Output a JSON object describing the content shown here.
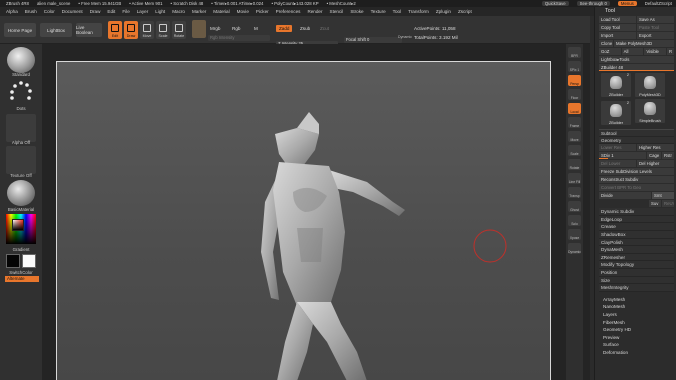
{
  "titlebar": {
    "app": "ZBrush 4R8",
    "file": "alien male_scene",
    "free_mem": "• Free Mem 15.941GB",
    "active_mem": "• Active Mem 901",
    "scratch": "• Scratch Disk 48",
    "timer": "• Timer▸0.001 ATime▸0.024",
    "polycount": "• PolyCount▸143.028 KP",
    "meshcount": "• MeshCount▸2",
    "quicksave": "QuickSave",
    "see_through": "See-through 0",
    "menus": "Menus",
    "default_script": "DefaultZScript"
  },
  "menubar": [
    "Alpha",
    "Brush",
    "Color",
    "Document",
    "Draw",
    "Edit",
    "File",
    "Layer",
    "Light",
    "Macro",
    "Marker",
    "Material",
    "Movie",
    "Picker",
    "Preferences",
    "Render",
    "Stencil",
    "Stroke",
    "Texture",
    "Tool",
    "Transform",
    "Zplugin",
    "Zscript"
  ],
  "shelf": {
    "home_page": "Home Page",
    "lightbox": "LightBox",
    "live_boolean": "Live Boolean",
    "tools": [
      {
        "label": "Edit",
        "icon": "edit-icon",
        "active": true
      },
      {
        "label": "Draw",
        "icon": "draw-icon",
        "active": true
      },
      {
        "label": "Move",
        "icon": "move-icon",
        "active": false
      },
      {
        "label": "Scale",
        "icon": "scale-icon",
        "active": false
      },
      {
        "label": "Rotate",
        "icon": "rotate-icon",
        "active": false
      }
    ],
    "mrgb": "Mrgb",
    "rgb": "Rgb",
    "m": "M",
    "zadd": "Zadd",
    "zsub": "Zsub",
    "zcut": "Zcut",
    "rgb_intensity": "Rgb Intensity",
    "z_intensity": "Z Intensity 25",
    "z_intensity_value": 25,
    "focal_shift": "Focal Shift 0",
    "draw_size": "Draw Size 64",
    "draw_size_value": 64,
    "dynamic": "Dynamic",
    "active_points": "ActivePoints: 11,058",
    "total_points": "TotalPoints: 3.192 Mil"
  },
  "leftpanel": {
    "brush": "Standard",
    "stroke": "Dots",
    "alpha": "Alpha Off",
    "texture": "Texture Off",
    "material": "BasicMaterial",
    "gradient": "Gradient",
    "switch_color": "SwitchColor",
    "alternate": "Alternate"
  },
  "rightstrip": [
    "BPR",
    "SPix 1",
    "Persp",
    "Floor",
    "Local",
    "Frame",
    "Move",
    "Scale",
    "Rotate",
    "Line Fill",
    "Transp",
    "Ghost",
    "Solo",
    "Xpose",
    "Dynamic"
  ],
  "toolpanel": {
    "title": "Tool",
    "load_tool": "Load Tool",
    "save_as": "Save As",
    "copy_tool": "Copy Tool",
    "paste_tool": "Paste Tool",
    "import": "Import",
    "export": "Export",
    "clone": "Clone",
    "make_polymesh": "Make PolyMesh3D",
    "goz": "GoZ",
    "all": "All",
    "visible": "Visible",
    "r": "R",
    "lightbox_tools": "Lightbox▸Tools",
    "zbuilder": "ZBuilder 48",
    "thumbs": [
      {
        "label": "ZBuilder",
        "count": "2"
      },
      {
        "label": "PolyMesh3D",
        "count": ""
      },
      {
        "label": "SimpleBrush",
        "count": ""
      },
      {
        "label": "ZBuilder",
        "count": "2"
      }
    ],
    "subtool": "Subtool",
    "geometry": "Geometry",
    "lower_res": "Lower Res",
    "higher_res": "Higher Res",
    "sdiv": "SDiv 1",
    "cage": "Cage",
    "rstr": "Rstr",
    "del_lower": "Del Lower",
    "del_higher": "Del Higher",
    "freeze": "Freeze SubDivision Levels",
    "reconstruct": "Reconstruct Subdiv",
    "convert_bpr": "Convert BPR To Geo",
    "divide": "Divide",
    "smt": "Smt",
    "suv": "Suv",
    "reuv": "ReUV",
    "items": [
      "Dynamic Subdiv",
      "EdgeLoop",
      "Crease",
      "ShadowBox",
      "ClayPolish",
      "DynaMesh",
      "ZRemesher",
      "Modify Topology",
      "Position",
      "Size",
      "MeshIntegrity"
    ],
    "subs": [
      "ArrayMesh",
      "NanoMesh",
      "Layers",
      "FiberMesh",
      "Geometry HD",
      "Preview",
      "Surface",
      "Deformation"
    ]
  },
  "colors": {
    "accent": "#e8762c",
    "background": "#2b2b2b",
    "canvas": "#555555"
  }
}
